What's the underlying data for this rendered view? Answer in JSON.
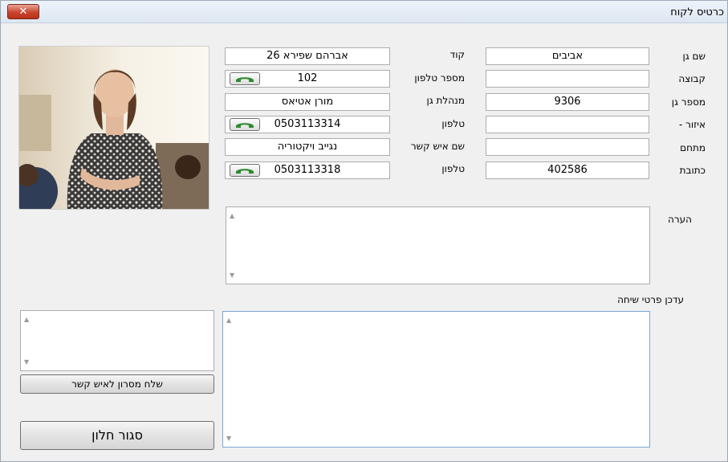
{
  "window": {
    "title": "כרטיס לקוח",
    "close_label": "✕"
  },
  "form": {
    "right_labels": [
      "שם גן",
      "קבוצה",
      "מספר גן",
      "איזור -",
      "מתחם",
      "כתובת"
    ],
    "right_values": [
      "אביבים",
      "",
      "9306",
      "",
      "",
      "402586"
    ],
    "mid_labels": [
      "קוד",
      "מספר טלפון",
      "מנהלת גן",
      "טלפון",
      "שם איש קשר",
      "טלפון"
    ],
    "mid_values": [
      "אברהם שפירא  26",
      "102",
      "מורן אטיאס",
      "0503113314",
      "נגייב ויקטוריה",
      "0503113318"
    ]
  },
  "note": {
    "label": "הערה",
    "value": ""
  },
  "conversation": {
    "label": "עדכן פרטי שיחה",
    "value": ""
  },
  "sms": {
    "value": "",
    "send_label": "שלח מסרון לאיש קשר"
  },
  "close_window_label": "סגור חלון",
  "icons": {
    "phone": "phone-handset-icon",
    "up": "scroll-up-arrow",
    "down": "scroll-down-arrow"
  },
  "colors": {
    "close": "#c8452c",
    "phone": "#2f8a2f",
    "title_bar": "#dce6f2"
  }
}
